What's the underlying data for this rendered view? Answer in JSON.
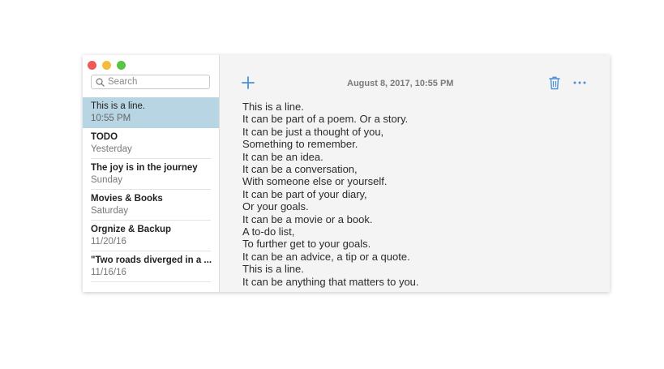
{
  "window": {
    "controls": [
      "close",
      "minimize",
      "zoom"
    ]
  },
  "sidebar": {
    "search": {
      "placeholder": "Search",
      "value": ""
    },
    "notes": [
      {
        "title": "This is a line.",
        "date": "10:55 PM",
        "selected": true
      },
      {
        "title": "TODO",
        "date": "Yesterday",
        "selected": false
      },
      {
        "title": "The joy is in the journey",
        "date": "Sunday",
        "selected": false
      },
      {
        "title": "Movies & Books",
        "date": "Saturday",
        "selected": false
      },
      {
        "title": "Orgnize & Backup",
        "date": "11/20/16",
        "selected": false
      },
      {
        "title": "\"Two roads diverged in a ...",
        "date": "11/16/16",
        "selected": false
      }
    ]
  },
  "toolbar": {
    "add_icon": "plus-icon",
    "date": "August 8, 2017, 10:55 PM",
    "trash_icon": "trash-icon",
    "more_icon": "more-icon"
  },
  "note": {
    "lines": [
      "This is a line.",
      "It can be part of a poem. Or a story.",
      "It can be just a thought of you,",
      "Something to remember.",
      "It can be an idea.",
      "It can be a conversation,",
      "With someone else or yourself.",
      "It can be part of your diary,",
      "Or your goals.",
      "It can be a movie or a book.",
      "A to-do list,",
      "To further get to your goals.",
      "It can be an advice, a tip or a quote.",
      "This is a line.",
      "It can be anything that matters to you."
    ]
  },
  "colors": {
    "accent": "#4a90d9",
    "selection": "#b8d5e4",
    "close": "#ee5b57",
    "minimize": "#f2bd3d",
    "zoom": "#5ac545"
  }
}
